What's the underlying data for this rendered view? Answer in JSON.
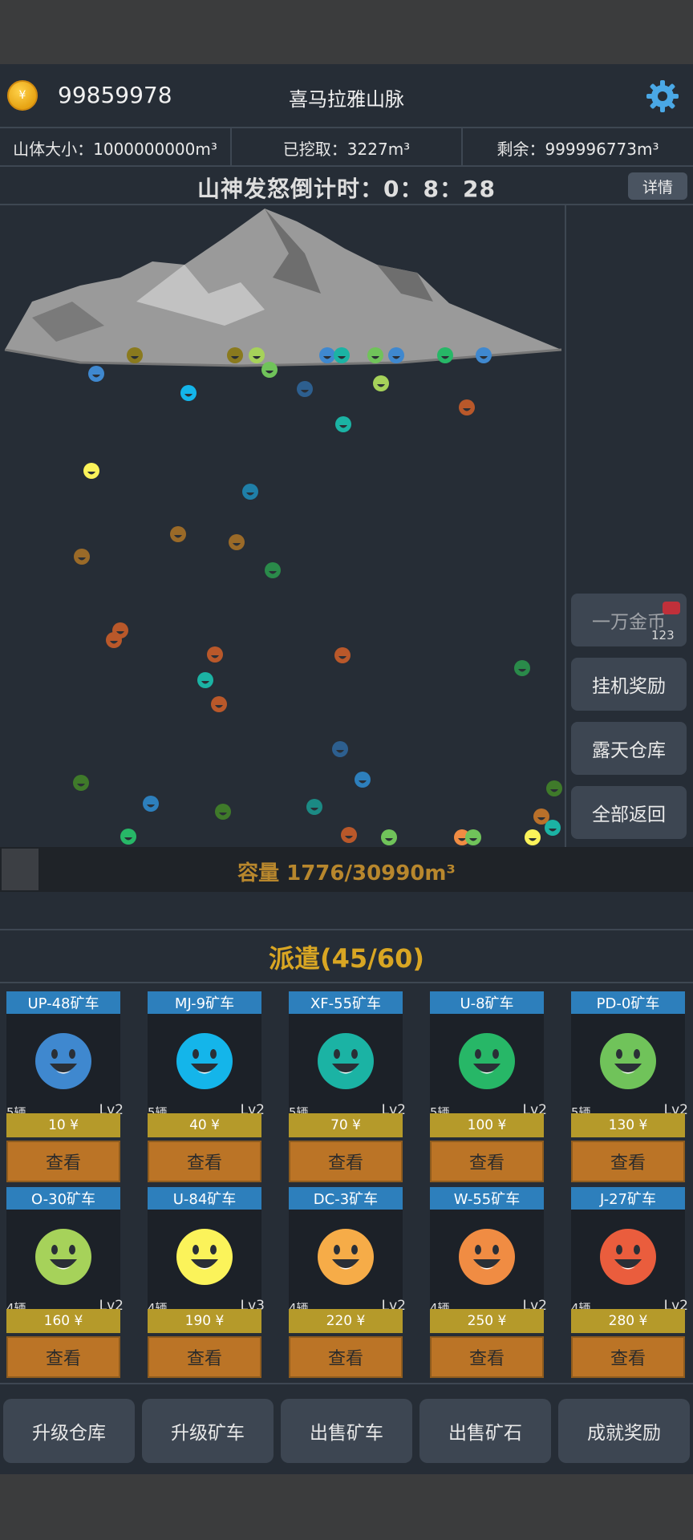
{
  "header": {
    "coin_symbol": "¥",
    "money": "99859978",
    "title": "喜马拉雅山脉"
  },
  "stats": {
    "mountain_size": "山体大小：1000000000m³",
    "mined": "已挖取：3227m³",
    "remaining": "剩余：999996773m³"
  },
  "countdown": "山神发怒倒计时：0：8：28",
  "detail_button": "详情",
  "side_buttons": {
    "ten_thousand_coins": "一万金币",
    "ten_thousand_count": "123",
    "idle_reward": "挂机奖励",
    "open_warehouse": "露天仓库",
    "return_all": "全部返回"
  },
  "capacity": "容量 1776/30990m³",
  "dispatch_title": "派遣(45/60)",
  "carts": [
    {
      "name": "UP-48矿车",
      "count": "5辆",
      "level": "Lv2",
      "price": "10 ¥",
      "view": "查看",
      "color": "#3f88cf"
    },
    {
      "name": "MJ-9矿车",
      "count": "5辆",
      "level": "Lv2",
      "price": "40 ¥",
      "view": "查看",
      "color": "#14b5ea"
    },
    {
      "name": "XF-55矿车",
      "count": "5辆",
      "level": "Lv2",
      "price": "70 ¥",
      "view": "查看",
      "color": "#1bb3a4"
    },
    {
      "name": "U-8矿车",
      "count": "5辆",
      "level": "Lv2",
      "price": "100 ¥",
      "view": "查看",
      "color": "#27b767"
    },
    {
      "name": "PD-0矿车",
      "count": "5辆",
      "level": "Lv2",
      "price": "130 ¥",
      "view": "查看",
      "color": "#70c35a"
    },
    {
      "name": "O-30矿车",
      "count": "4辆",
      "level": "Lv2",
      "price": "160 ¥",
      "view": "查看",
      "color": "#a6d25a"
    },
    {
      "name": "U-84矿车",
      "count": "4辆",
      "level": "Lv3",
      "price": "190 ¥",
      "view": "查看",
      "color": "#fbf35a"
    },
    {
      "name": "DC-3矿车",
      "count": "4辆",
      "level": "Lv2",
      "price": "220 ¥",
      "view": "查看",
      "color": "#f6ac48"
    },
    {
      "name": "W-55矿车",
      "count": "4辆",
      "level": "Lv2",
      "price": "250 ¥",
      "view": "查看",
      "color": "#f08c43"
    },
    {
      "name": "J-27矿车",
      "count": "4辆",
      "level": "Lv2",
      "price": "280 ¥",
      "view": "查看",
      "color": "#ea5d3d"
    }
  ],
  "bottom_buttons": [
    "升级仓库",
    "升级矿车",
    "出售矿车",
    "出售矿石",
    "成就奖励"
  ],
  "colors": {
    "panel_bg": "#262d36",
    "accent_gold": "#d9a623",
    "tab_blue": "#2d7fbc",
    "price_bar": "#b59a2a",
    "view_button": "#bb7426"
  },
  "icons": {
    "coin": "coin-icon",
    "settings": "gear-icon",
    "miner": "smiley-face-icon",
    "mountain": "mountain-illustration"
  }
}
